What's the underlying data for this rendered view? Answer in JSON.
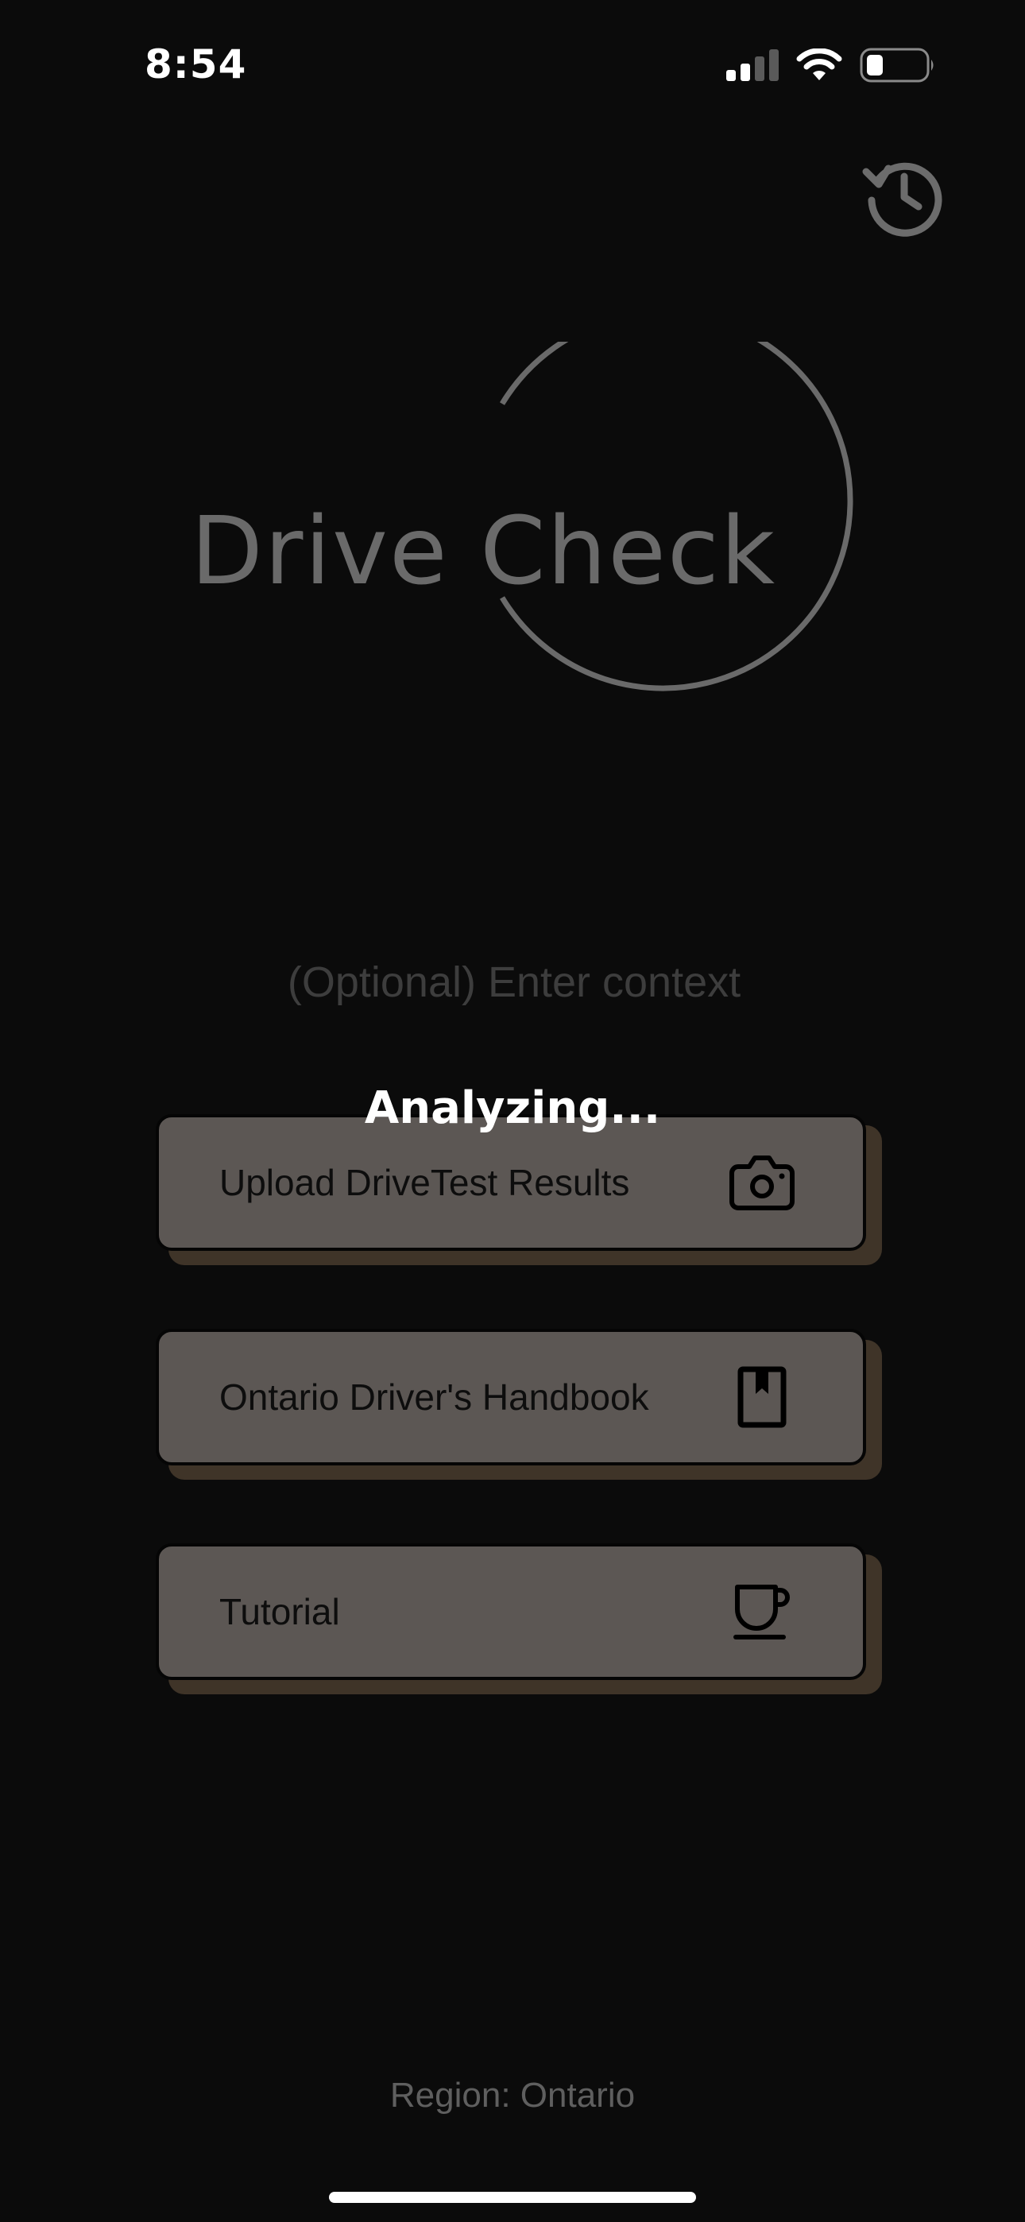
{
  "status_bar": {
    "time": "8:54",
    "icons": [
      "cellular-signal-icon",
      "wifi-icon",
      "battery-icon"
    ]
  },
  "header": {
    "history_icon": "history-icon"
  },
  "logo": {
    "text": "Drive Check"
  },
  "context": {
    "placeholder": "(Optional) Enter context",
    "value": ""
  },
  "overlay": {
    "status_text": "Analyzing..."
  },
  "actions": [
    {
      "label": "Upload DriveTest Results",
      "icon": "camera-icon"
    },
    {
      "label": "Ontario Driver's Handbook",
      "icon": "book-icon"
    },
    {
      "label": "Tutorial",
      "icon": "coffee-cup-icon"
    }
  ],
  "footer": {
    "region": "Region: Ontario"
  },
  "colors": {
    "background": "#0b0b0b",
    "button_face": "#5c5754",
    "button_shadow": "#3f3428",
    "logo_gray": "#6a6a6a"
  }
}
